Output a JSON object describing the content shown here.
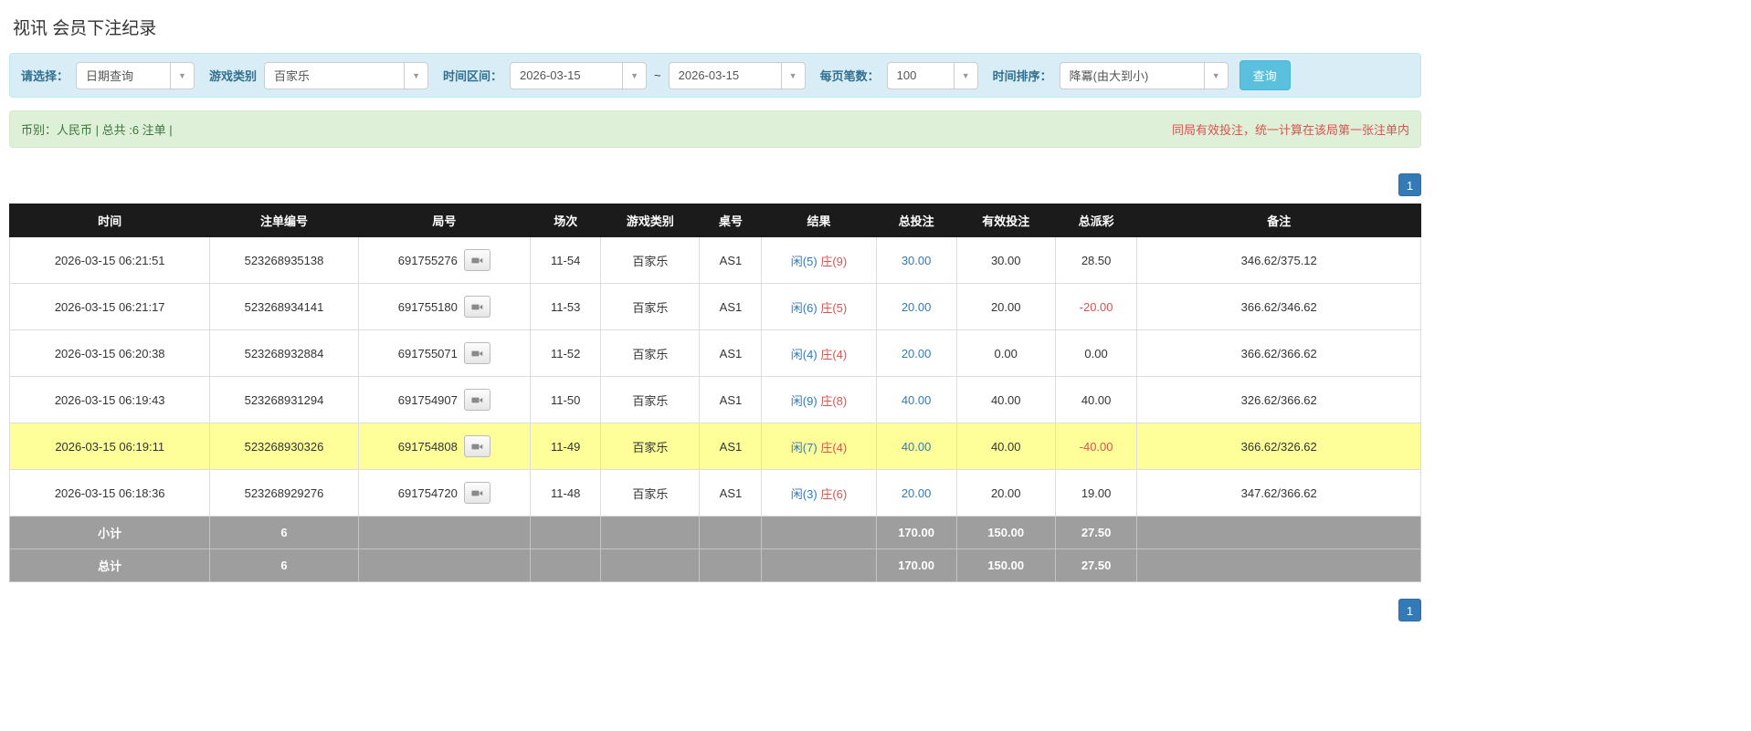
{
  "page_title": "视讯 会员下注纪录",
  "filters": {
    "select_label": "请选择：",
    "select_value": "日期查询",
    "game_type_label": "游戏类别",
    "game_type_value": "百家乐",
    "date_range_label": "时间区间：",
    "date_from": "2026-03-15",
    "tilde": "~",
    "date_to": "2026-03-15",
    "page_size_label": "每页笔数：",
    "page_size_value": "100",
    "sort_label": "时间排序：",
    "sort_value": "降冪(由大到小)",
    "search_button": "查询"
  },
  "info_bar": {
    "left": "币别：人民币 | 总共 :6 注单 |",
    "right": "同局有效投注，统一计算在该局第一张注单内"
  },
  "pagination": {
    "page": "1"
  },
  "icons": {
    "dropdown_caret": "chevron-down-icon",
    "round_replay": "video-camera-icon",
    "caret_glyph": "▼"
  },
  "colors": {
    "accent_blue": "#337ab7",
    "negative_red": "#d9534f",
    "highlight_yellow": "#ffff99",
    "header_black": "#1b1b1b",
    "footer_gray": "#9e9e9e",
    "filter_bar_bg": "#d9edf7",
    "info_bar_bg": "#dff0d8",
    "search_button_bg": "#5bc0de"
  },
  "table": {
    "headers": [
      "时间",
      "注单编号",
      "局号",
      "场次",
      "游戏类别",
      "桌号",
      "结果",
      "总投注",
      "有效投注",
      "总派彩",
      "备注"
    ],
    "rows": [
      {
        "time": "2026-03-15 06:21:51",
        "bet_id": "523268935138",
        "round": "691755276",
        "session": "11-54",
        "game": "百家乐",
        "table_no": "AS1",
        "result_player": "闲(5)",
        "result_banker": "庄(9)",
        "total_bet": "30.00",
        "valid_bet": "30.00",
        "payout": "28.50",
        "note": "346.62/375.12",
        "highlight": false
      },
      {
        "time": "2026-03-15 06:21:17",
        "bet_id": "523268934141",
        "round": "691755180",
        "session": "11-53",
        "game": "百家乐",
        "table_no": "AS1",
        "result_player": "闲(6)",
        "result_banker": "庄(5)",
        "total_bet": "20.00",
        "valid_bet": "20.00",
        "payout": "-20.00",
        "note": "366.62/346.62",
        "highlight": false
      },
      {
        "time": "2026-03-15 06:20:38",
        "bet_id": "523268932884",
        "round": "691755071",
        "session": "11-52",
        "game": "百家乐",
        "table_no": "AS1",
        "result_player": "闲(4)",
        "result_banker": "庄(4)",
        "total_bet": "20.00",
        "valid_bet": "0.00",
        "payout": "0.00",
        "note": "366.62/366.62",
        "highlight": false
      },
      {
        "time": "2026-03-15 06:19:43",
        "bet_id": "523268931294",
        "round": "691754907",
        "session": "11-50",
        "game": "百家乐",
        "table_no": "AS1",
        "result_player": "闲(9)",
        "result_banker": "庄(8)",
        "total_bet": "40.00",
        "valid_bet": "40.00",
        "payout": "40.00",
        "note": "326.62/366.62",
        "highlight": false
      },
      {
        "time": "2026-03-15 06:19:11",
        "bet_id": "523268930326",
        "round": "691754808",
        "session": "11-49",
        "game": "百家乐",
        "table_no": "AS1",
        "result_player": "闲(7)",
        "result_banker": "庄(4)",
        "total_bet": "40.00",
        "valid_bet": "40.00",
        "payout": "-40.00",
        "note": "366.62/326.62",
        "highlight": true
      },
      {
        "time": "2026-03-15 06:18:36",
        "bet_id": "523268929276",
        "round": "691754720",
        "session": "11-48",
        "game": "百家乐",
        "table_no": "AS1",
        "result_player": "闲(3)",
        "result_banker": "庄(6)",
        "total_bet": "20.00",
        "valid_bet": "20.00",
        "payout": "19.00",
        "note": "347.62/366.62",
        "highlight": false
      }
    ],
    "footer_rows": [
      {
        "name": "subtotal-row",
        "cells": [
          "小计",
          "6",
          "",
          "",
          "",
          "",
          "",
          "170.00",
          "150.00",
          "27.50",
          ""
        ]
      },
      {
        "name": "total-row",
        "cells": [
          "总计",
          "6",
          "",
          "",
          "",
          "",
          "",
          "170.00",
          "150.00",
          "27.50",
          ""
        ]
      }
    ]
  }
}
